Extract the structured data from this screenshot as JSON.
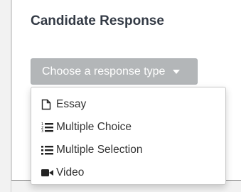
{
  "header": {
    "title": "Candidate Response"
  },
  "dropdown": {
    "label": "Choose a response type",
    "expanded": true,
    "items": [
      {
        "label": "Essay",
        "icon": "file-icon"
      },
      {
        "label": "Multiple Choice",
        "icon": "ordered-list-icon"
      },
      {
        "label": "Multiple Selection",
        "icon": "list-icon"
      },
      {
        "label": "Video",
        "icon": "video-camera-icon"
      }
    ]
  },
  "colors": {
    "toggle_bg": "#b3b6b8",
    "title_text": "#333a45",
    "menu_text": "#333333"
  }
}
